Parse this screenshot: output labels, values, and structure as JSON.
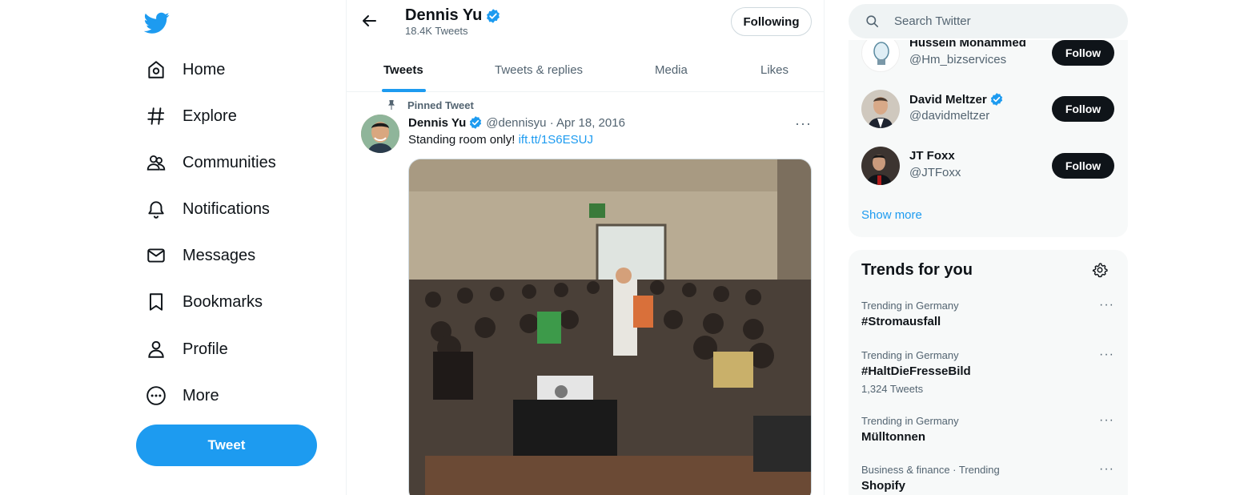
{
  "nav": {
    "items": [
      {
        "label": "Home",
        "icon": "home-icon"
      },
      {
        "label": "Explore",
        "icon": "hashtag-icon"
      },
      {
        "label": "Communities",
        "icon": "communities-icon"
      },
      {
        "label": "Notifications",
        "icon": "bell-icon"
      },
      {
        "label": "Messages",
        "icon": "envelope-icon"
      },
      {
        "label": "Bookmarks",
        "icon": "bookmark-icon"
      },
      {
        "label": "Profile",
        "icon": "person-icon"
      },
      {
        "label": "More",
        "icon": "more-circle-icon"
      }
    ],
    "tweet_button": "Tweet"
  },
  "profile_header": {
    "name": "Dennis Yu",
    "tweet_count": "18.4K Tweets",
    "following_button": "Following"
  },
  "tabs": [
    {
      "label": "Tweets",
      "active": true
    },
    {
      "label": "Tweets & replies",
      "active": false
    },
    {
      "label": "Media",
      "active": false
    },
    {
      "label": "Likes",
      "active": false
    }
  ],
  "pinned_tweet": {
    "pinned_label": "Pinned Tweet",
    "author": "Dennis Yu",
    "meta": "@dennisyu · Apr 18, 2016",
    "text": "Standing room only!",
    "link": "ift.tt/1S6ESUJ",
    "more": "···"
  },
  "search": {
    "placeholder": "Search Twitter"
  },
  "who_to_follow": {
    "accounts": [
      {
        "name": "Hussein Mohammed",
        "handle": "@Hm_bizservices",
        "button": "Follow",
        "verified": false
      },
      {
        "name": "David Meltzer",
        "handle": "@davidmeltzer",
        "button": "Follow",
        "verified": true
      },
      {
        "name": "JT Foxx",
        "handle": "@JTFoxx",
        "button": "Follow",
        "verified": false
      }
    ],
    "show_more": "Show more"
  },
  "trends": {
    "title": "Trends for you",
    "items": [
      {
        "context": "Trending in Germany",
        "title": "#Stromausfall",
        "count": ""
      },
      {
        "context": "Trending in Germany",
        "title": "#HaltDieFresseBild",
        "count": "1,324 Tweets"
      },
      {
        "context": "Trending in Germany",
        "title": "Mülltonnen",
        "count": ""
      },
      {
        "context": "Business & finance · Trending",
        "title": "Shopify",
        "count": ""
      }
    ]
  },
  "colors": {
    "accent": "#1d9bf0",
    "text_primary": "#0f1419",
    "text_secondary": "#536471",
    "panel_bg": "#f7f9f9"
  }
}
